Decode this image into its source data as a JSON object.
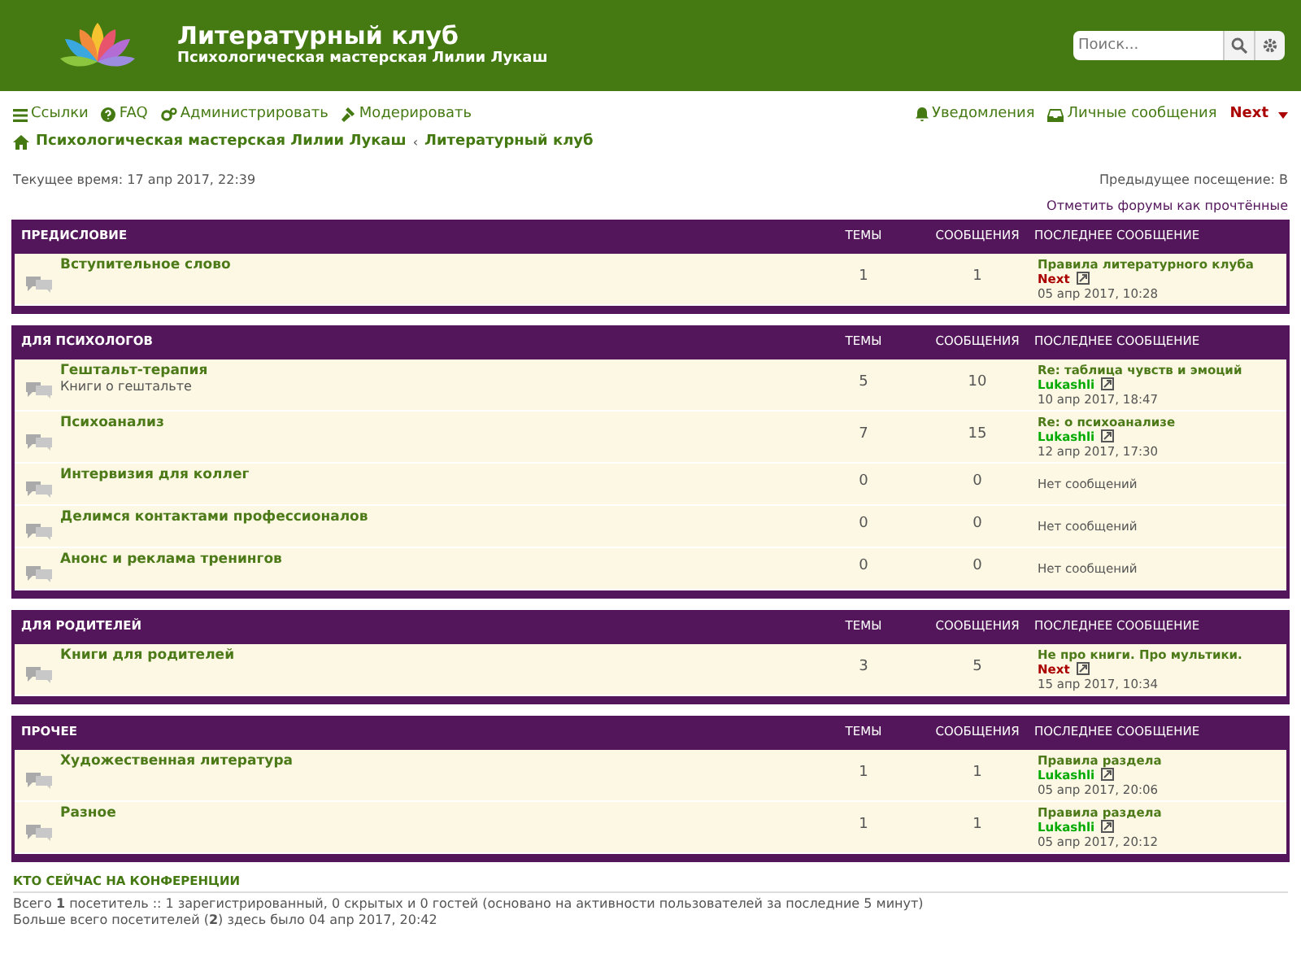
{
  "header": {
    "site_title": "Литературный клуб",
    "site_description": "Психологическая мастерская Лилии Лукаш",
    "search": {
      "placeholder": "Поиск..."
    }
  },
  "nav": {
    "left": [
      {
        "kind": "menu",
        "label": "Ссылки"
      },
      {
        "kind": "help",
        "label": "FAQ"
      },
      {
        "kind": "admin",
        "label": "Администрировать"
      },
      {
        "kind": "moderate",
        "label": "Модерировать"
      }
    ],
    "right": [
      {
        "kind": "bell",
        "label": "Уведомления"
      },
      {
        "kind": "inbox",
        "label": "Личные сообщения"
      }
    ],
    "user": "Next"
  },
  "breadcrumb_separator": "‹",
  "breadcrumbs": [
    "Психологическая мастерская Лилии Лукаш",
    "Литературный клуб"
  ],
  "current_time": "Текущее время: 17 апр 2017, 22:39",
  "last_visit": "Предыдущее посещение: В",
  "mark_read": "Отметить форумы как прочтённые",
  "categories": [
    {
      "title": "ПРЕДИСЛОВИЕ",
      "col_topics": "ТЕМЫ",
      "col_posts": "СООБЩЕНИЯ",
      "col_last": "ПОСЛЕДНЕЕ СООБЩЕНИЕ",
      "forums": [
        {
          "title": "Вступительное слово",
          "topics": "1",
          "posts": "1",
          "last_post": {
            "title": "Правила литературного клуба",
            "author": "Next",
            "color": "#aa0000",
            "date": "05 апр 2017, 10:28"
          }
        }
      ]
    },
    {
      "title": "ДЛЯ ПСИХОЛОГОВ",
      "col_topics": "ТЕМЫ",
      "col_posts": "СООБЩЕНИЯ",
      "col_last": "ПОСЛЕДНЕЕ СООБЩЕНИЕ",
      "forums": [
        {
          "title": "Гештальт-терапия",
          "description": "Книги о гештальте",
          "topics": "5",
          "posts": "10",
          "last_post": {
            "title": "Re: таблица чувств и эмоций",
            "author": "Lukashli",
            "color": "#00aa00",
            "date": "10 апр 2017, 18:47"
          }
        },
        {
          "title": "Психоанализ",
          "topics": "7",
          "posts": "15",
          "last_post": {
            "title": "Re: о психоанализе",
            "author": "Lukashli",
            "color": "#00aa00",
            "date": "12 апр 2017, 17:30"
          }
        },
        {
          "title": "Интервизия для коллег",
          "topics": "0",
          "posts": "0",
          "no_posts": "Нет сообщений"
        },
        {
          "title": "Делимся контактами профессионалов",
          "topics": "0",
          "posts": "0",
          "no_posts": "Нет сообщений"
        },
        {
          "title": "Анонс и реклама тренингов",
          "topics": "0",
          "posts": "0",
          "no_posts": "Нет сообщений"
        }
      ]
    },
    {
      "title": "ДЛЯ РОДИТЕЛЕЙ",
      "col_topics": "ТЕМЫ",
      "col_posts": "СООБЩЕНИЯ",
      "col_last": "ПОСЛЕДНЕЕ СООБЩЕНИЕ",
      "forums": [
        {
          "title": "Книги для родителей",
          "topics": "3",
          "posts": "5",
          "last_post": {
            "title": "Не про книги. Про мультики.",
            "author": "Next",
            "color": "#aa0000",
            "date": "15 апр 2017, 10:34"
          }
        }
      ]
    },
    {
      "title": "ПРОЧЕЕ",
      "col_topics": "ТЕМЫ",
      "col_posts": "СООБЩЕНИЯ",
      "col_last": "ПОСЛЕДНЕЕ СООБЩЕНИЕ",
      "forums": [
        {
          "title": "Художественная литература",
          "topics": "1",
          "posts": "1",
          "last_post": {
            "title": "Правила раздела",
            "author": "Lukashli",
            "color": "#00aa00",
            "date": "05 апр 2017, 20:06"
          }
        },
        {
          "title": "Разное",
          "topics": "1",
          "posts": "1",
          "last_post": {
            "title": "Правила раздела",
            "author": "Lukashli",
            "color": "#00aa00",
            "date": "05 апр 2017, 20:12"
          }
        }
      ]
    }
  ],
  "who_online": {
    "title": "КТО СЕЙЧАС НА КОНФЕРЕНЦИИ",
    "lines": [
      "Всего **1** посетитель :: 1 зарегистрированный, 0 скрытых и 0 гостей (основано на активности пользователей за последние 5 минут)",
      "Больше всего посетителей (**2**) здесь было 04 апр 2017, 20:42"
    ]
  }
}
